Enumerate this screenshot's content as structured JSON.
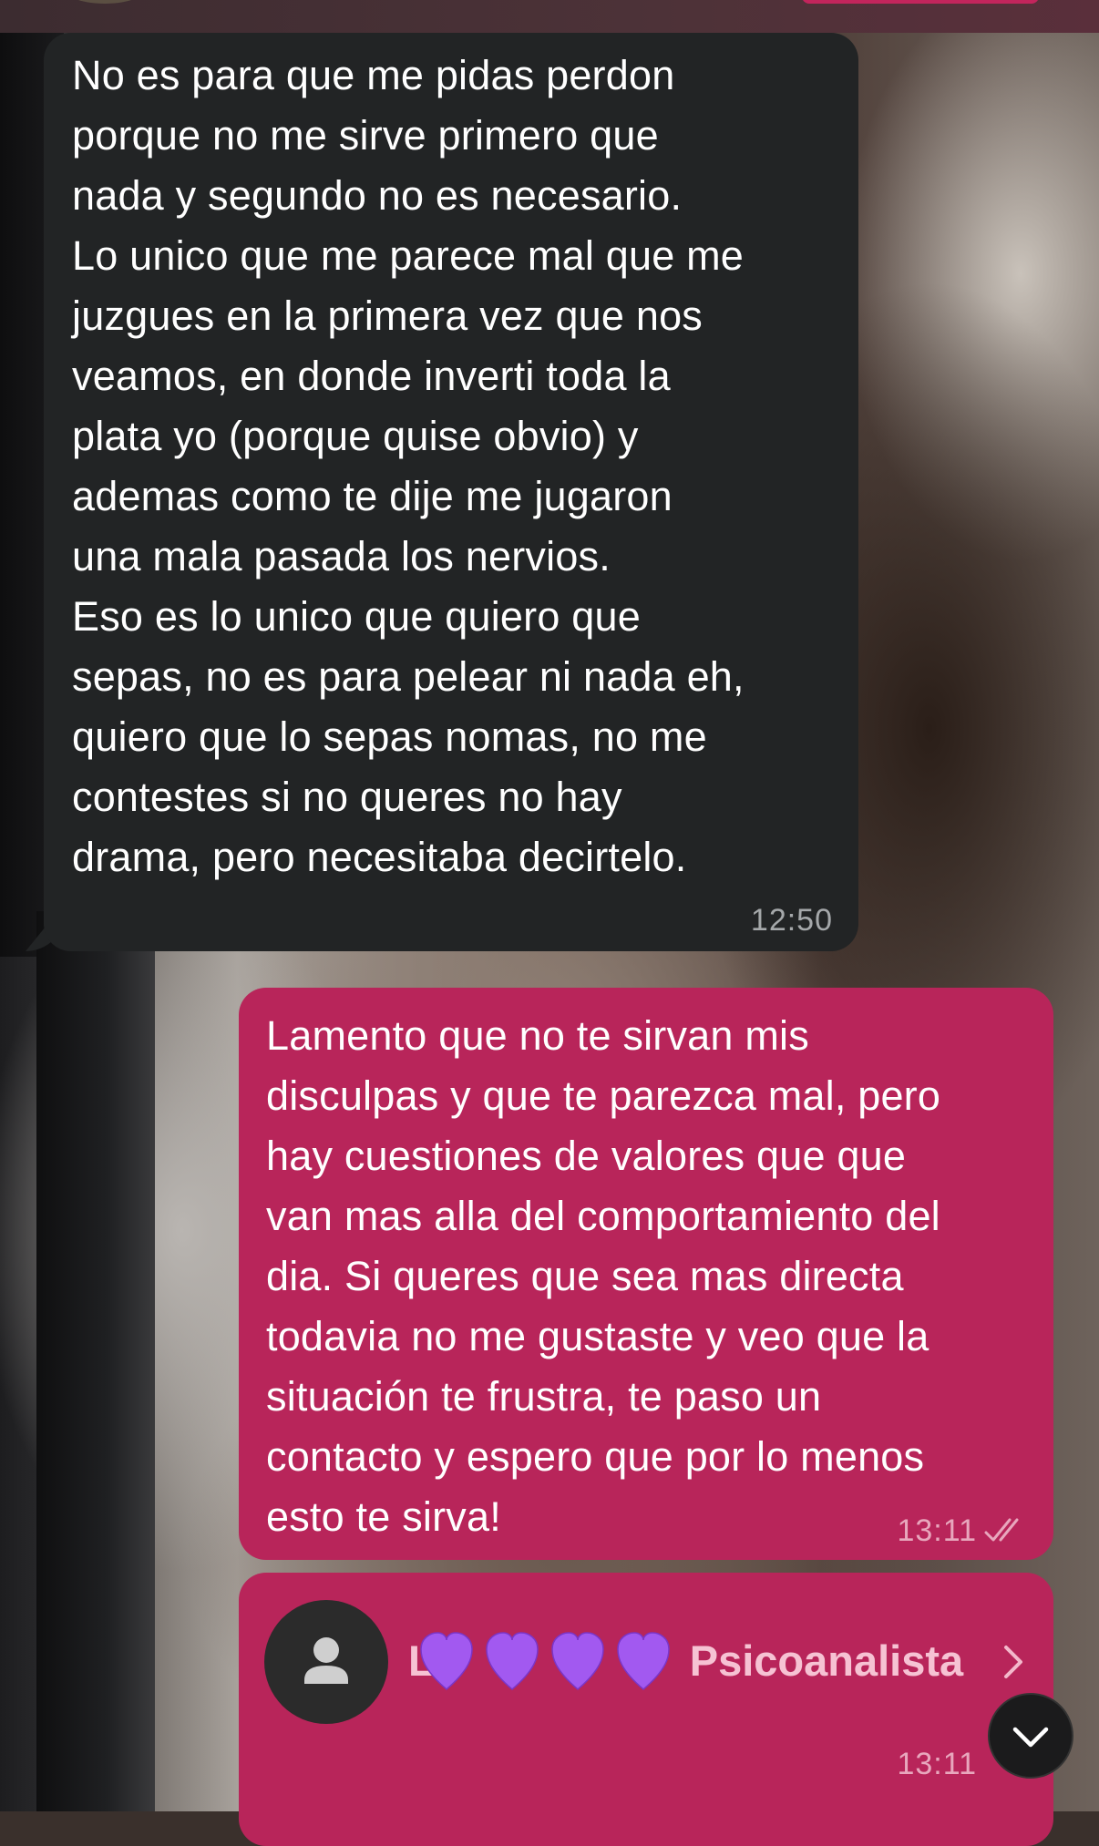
{
  "incoming_message": {
    "text": "No es para que me pidas perdon\nporque no me sirve primero que\nnada y segundo no es necesario.\nLo unico que me parece mal que me\njuzgues en la primera vez que nos\nveamos, en donde inverti toda la\nplata yo (porque quise obvio) y\nademas como te dije me jugaron\nuna mala pasada los nervios.\nEso es lo unico que quiero que\nsepas, no es para pelear ni nada eh,\nquiero que lo sepas nomas, no me\ncontestes si no queres no hay\ndrama, pero necesitaba decirtelo.",
    "time": "12:50"
  },
  "outgoing_message": {
    "text": "Lamento que no te sirvan mis\ndisculpas y que te parezca mal, pero\nhay cuestiones de valores que que\nvan mas alla del comportamiento del\ndia. Si queres que sea mas directa\ntodavia no me gustaste y veo que la\nsituación te frustra, te paso un\ncontacto y espero que por lo menos\nesto te sirva!",
    "time": "13:11",
    "status_icon": "double-check-icon"
  },
  "contact_message": {
    "name_visible": "L              Psicoanalista",
    "name_suffix": "Psicoanalista",
    "name_prefix": "L",
    "time": "13:11",
    "avatar_icon": "person-icon",
    "overlay_icon": "purple-heart-icon",
    "chevron_icon": "chevron-right-icon"
  },
  "scroll_button": {
    "icon": "chevron-down-icon"
  },
  "colors": {
    "incoming_bubble": "#222425",
    "outgoing_bubble": "#b8255a",
    "incoming_time": "#a5a8aa",
    "outgoing_time": "#e8a7bd",
    "heart": "#a259f0"
  }
}
